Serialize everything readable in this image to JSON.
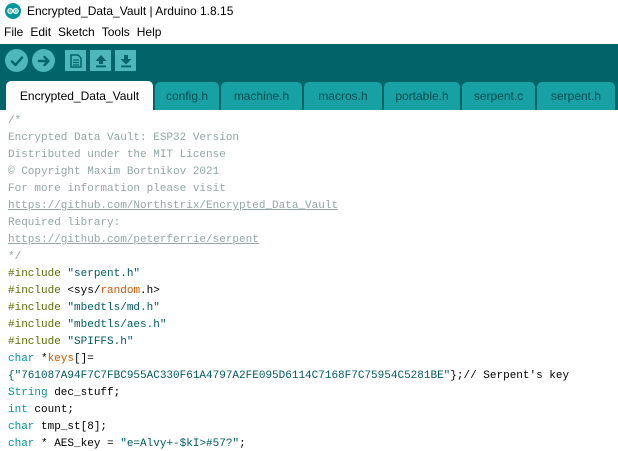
{
  "window": {
    "title": "Encrypted_Data_Vault | Arduino 1.8.15"
  },
  "menu": [
    "File",
    "Edit",
    "Sketch",
    "Tools",
    "Help"
  ],
  "toolbar": [
    "verify",
    "upload",
    "new",
    "open",
    "save"
  ],
  "tabs": [
    "Encrypted_Data_Vault",
    "config.h",
    "machine.h",
    "macros.h",
    "portable.h",
    "serpent.c",
    "serpent.h"
  ],
  "code": {
    "l1": "/*",
    "l2": "Encrypted Data Vault: ESP32 Version",
    "l3": "Distributed under the MIT License",
    "l4": "© Copyright Maxim Bortnikov 2021",
    "l5": "For more information please visit",
    "l6": "https://github.com/Northstrix/Encrypted_Data_Vault",
    "l7": "Required library:",
    "l8": "https://github.com/peterferrie/serpent",
    "l9": "*/",
    "inc": "#include",
    "inc1": "\"serpent.h\"",
    "inc2_a": "<sys/",
    "inc2_b": "random",
    "inc2_c": ".h>",
    "inc3": "\"mbedtls/md.h\"",
    "inc4": "\"mbedtls/aes.h\"",
    "inc5": "\"SPIFFS.h\"",
    "l15_type": "char",
    "l15_a": " *",
    "l15_b": "keys",
    "l15_c": "[]=",
    "l16_str": "{\"761087A94F7C7FBC955AC330F61A4797A2FE095D6114C7168F7C75954C5281BE\"",
    "l16_rest": "};// Serpent's key",
    "l17_type": "String",
    "l17_rest": " dec_stuff;",
    "l18_type": "int",
    "l18_rest": " count;",
    "l19_type": "char",
    "l19_rest": " tmp_st[8];",
    "l20_type": "char",
    "l20_mid": " * AES_key = ",
    "l20_str": "\"e=Alvy+-$kI>#57?\"",
    "l20_end": ";"
  }
}
